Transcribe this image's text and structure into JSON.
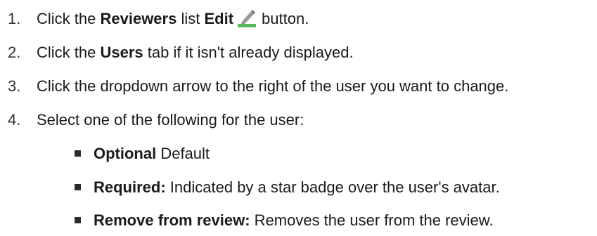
{
  "steps": [
    {
      "number": "1.",
      "pre": "Click the ",
      "bold1": "Reviewers",
      "mid": " list ",
      "bold2": "Edit",
      "icon": "pencil-edit-icon",
      "post": "button."
    },
    {
      "number": "2.",
      "pre": "Click the ",
      "bold": "Users",
      "post": " tab if it isn't already displayed."
    },
    {
      "number": "3.",
      "text": "Click the dropdown arrow to the right of the user you want to change."
    },
    {
      "number": "4.",
      "text": "Select one of the following for the user:"
    }
  ],
  "options": [
    {
      "bold": "Optional",
      "text": " Default"
    },
    {
      "bold": "Required:",
      "text": " Indicated by a star badge over the user's avatar."
    },
    {
      "bold": "Remove from review:",
      "text": " Removes the user from the review."
    }
  ],
  "colors": {
    "text": "#1a1a1a",
    "icon_bar": "#5cb85c",
    "icon_pencil": "#8a8a8a"
  }
}
